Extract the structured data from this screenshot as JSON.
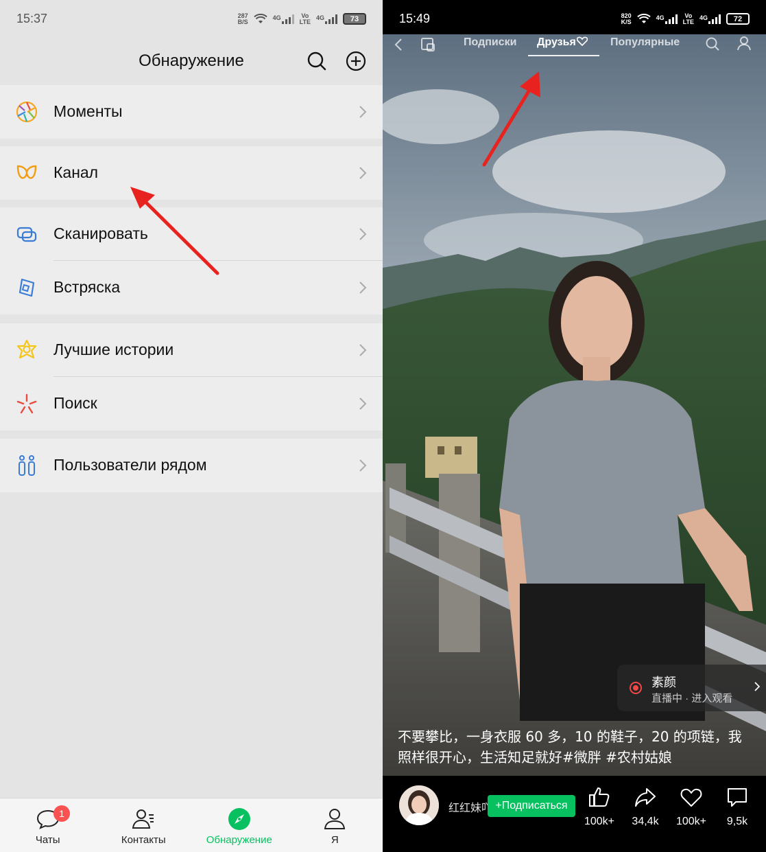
{
  "left": {
    "status": {
      "time": "15:37",
      "speed_top": "287",
      "speed_bottom": "B/S",
      "net1": "4G",
      "volte_top": "Vo",
      "volte_bottom": "LTE",
      "net2": "4G",
      "battery": "73"
    },
    "header": {
      "title": "Обнаружение",
      "search_icon": "search-icon",
      "add_icon": "plus-circle-icon"
    },
    "menu": [
      {
        "label": "Моменты",
        "icon": "moments-aperture-icon"
      },
      {
        "label": "Канал",
        "icon": "channels-icon"
      },
      {
        "label": "Сканировать",
        "icon": "scan-icon"
      },
      {
        "label": "Встряска",
        "icon": "shake-icon"
      },
      {
        "label": "Лучшие истории",
        "icon": "top-stories-icon"
      },
      {
        "label": "Поиск",
        "icon": "search-sparkle-icon"
      },
      {
        "label": "Пользователи рядом",
        "icon": "people-nearby-icon"
      }
    ],
    "tabs": [
      {
        "label": "Чаты",
        "icon": "chat-bubble-icon",
        "badge": "1"
      },
      {
        "label": "Контакты",
        "icon": "contacts-icon"
      },
      {
        "label": "Обнаружение",
        "icon": "compass-icon",
        "active": true
      },
      {
        "label": "Я",
        "icon": "person-icon"
      }
    ],
    "accent": "#07c160",
    "annotation_color": "#e8231f"
  },
  "right": {
    "status": {
      "time": "15:49",
      "speed_top": "820",
      "speed_bottom": "K/S",
      "net1": "4G",
      "volte_top": "Vo",
      "volte_bottom": "LTE",
      "net2": "4G",
      "battery": "72"
    },
    "top_tabs": {
      "subscriptions": "Подписки",
      "friends": "Друзья",
      "popular": "Популярные"
    },
    "live": {
      "name": "素颜",
      "sub": "直播中 · 进入观看"
    },
    "caption": "不要攀比，一身衣服 60 多，10 的鞋子，20 的项链，我照样很开心，生活知足就好#微胖 #农村姑娘",
    "author": {
      "name": "红红妹吖",
      "follow_label": "+Подписаться"
    },
    "actions": [
      {
        "icon": "thumbs-up-icon",
        "count": "100k+"
      },
      {
        "icon": "share-arrow-icon",
        "count": "34,4k"
      },
      {
        "icon": "heart-icon",
        "count": "100k+"
      },
      {
        "icon": "comment-icon",
        "count": "9,5k"
      }
    ]
  }
}
